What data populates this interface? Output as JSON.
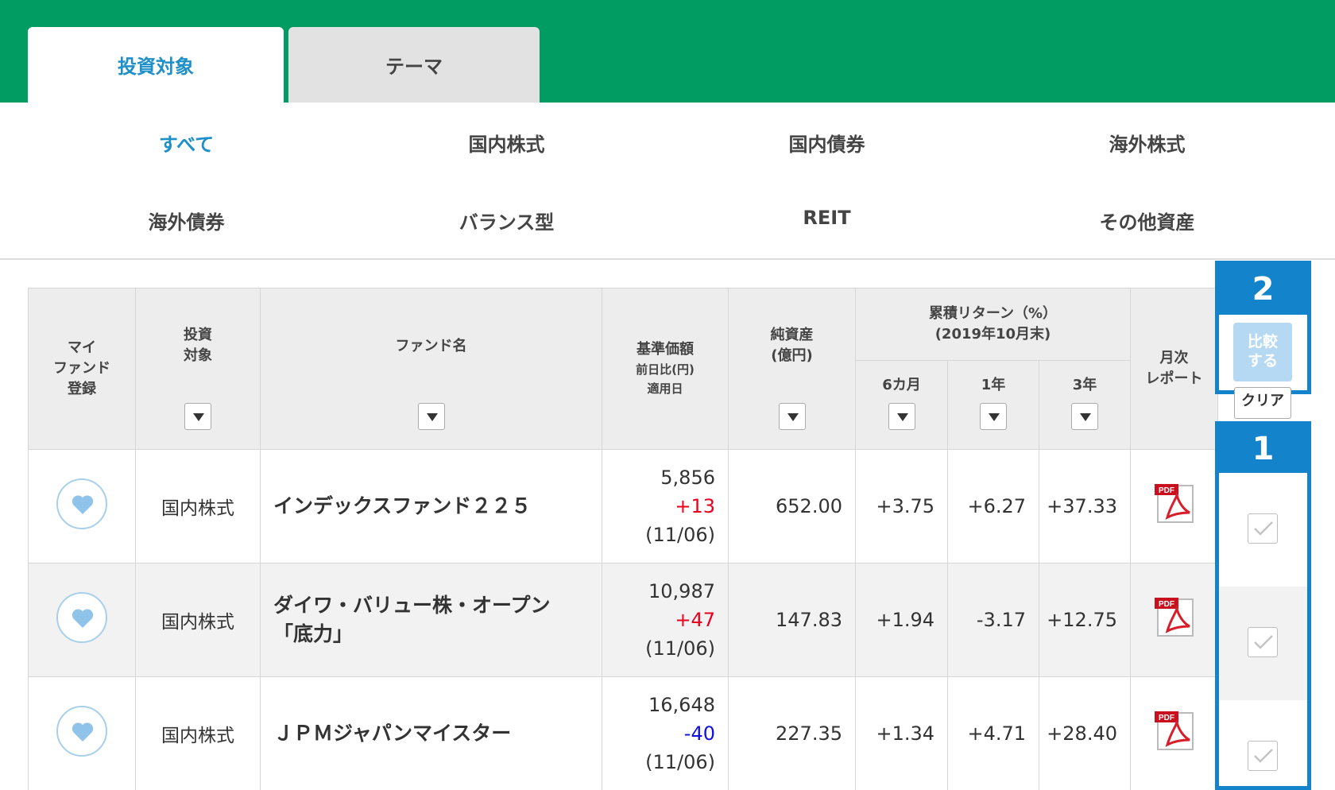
{
  "tabs": [
    {
      "label": "投資対象",
      "active": true
    },
    {
      "label": "テーマ",
      "active": false
    }
  ],
  "categories": [
    {
      "label": "すべて",
      "selected": true
    },
    {
      "label": "国内株式",
      "selected": false
    },
    {
      "label": "国内債券",
      "selected": false
    },
    {
      "label": "海外株式",
      "selected": false
    },
    {
      "label": "海外債券",
      "selected": false
    },
    {
      "label": "バランス型",
      "selected": false
    },
    {
      "label": "REIT",
      "selected": false
    },
    {
      "label": "その他資産",
      "selected": false
    }
  ],
  "table": {
    "headers": {
      "myfund": [
        "マイ",
        "ファンド",
        "登録"
      ],
      "target": [
        "投資",
        "対象"
      ],
      "fund_name": "ファンド名",
      "price": "基準価額",
      "price_sub1": "前日比(円)",
      "price_sub2": "適用日",
      "assets": [
        "純資産",
        "(億円)"
      ],
      "returns": [
        "累積リターン（%）",
        "(2019年10月末)"
      ],
      "ret_6m": "6カ月",
      "ret_1y": "1年",
      "ret_3y": "3年",
      "report": [
        "月次",
        "レポート"
      ]
    },
    "rows": [
      {
        "target": "国内株式",
        "name_lines": [
          "インデックスファンド２２５",
          ""
        ],
        "price": "5,856",
        "change": "+13",
        "change_sign": "pos",
        "date": "(11/06)",
        "assets": "652.00",
        "ret_6m": "+3.75",
        "ret_6m_sign": "pos",
        "ret_1y": "+6.27",
        "ret_1y_sign": "pos",
        "ret_3y": "+37.33",
        "ret_3y_sign": "pos"
      },
      {
        "target": "国内株式",
        "name_lines": [
          "ダイワ・バリュー株・オープン",
          "「底力」"
        ],
        "price": "10,987",
        "change": "+47",
        "change_sign": "pos",
        "date": "(11/06)",
        "assets": "147.83",
        "ret_6m": "+1.94",
        "ret_6m_sign": "pos",
        "ret_1y": "-3.17",
        "ret_1y_sign": "neg",
        "ret_3y": "+12.75",
        "ret_3y_sign": "pos"
      },
      {
        "target": "国内株式",
        "name_lines": [
          "ＪＰＭジャパンマイスター",
          ""
        ],
        "price": "16,648",
        "change": "-40",
        "change_sign": "neg",
        "date": "(11/06)",
        "assets": "227.35",
        "ret_6m": "+1.34",
        "ret_6m_sign": "pos",
        "ret_1y": "+4.71",
        "ret_1y_sign": "pos",
        "ret_3y": "+28.40",
        "ret_3y_sign": "pos"
      }
    ]
  },
  "compare": {
    "step2": "2",
    "button": [
      "比較",
      "する"
    ],
    "clear": "クリア",
    "step1": "1"
  },
  "icons": {
    "heart": "heart-icon",
    "pdf": "pdf-report-icon",
    "sort": "sort-down-icon",
    "check": "check-icon"
  },
  "colors": {
    "brand_green": "#009c62",
    "accent_blue": "#1e8fc8",
    "highlight_blue": "#1384cc",
    "positive": "#e8001c",
    "negative": "#1010e0"
  }
}
